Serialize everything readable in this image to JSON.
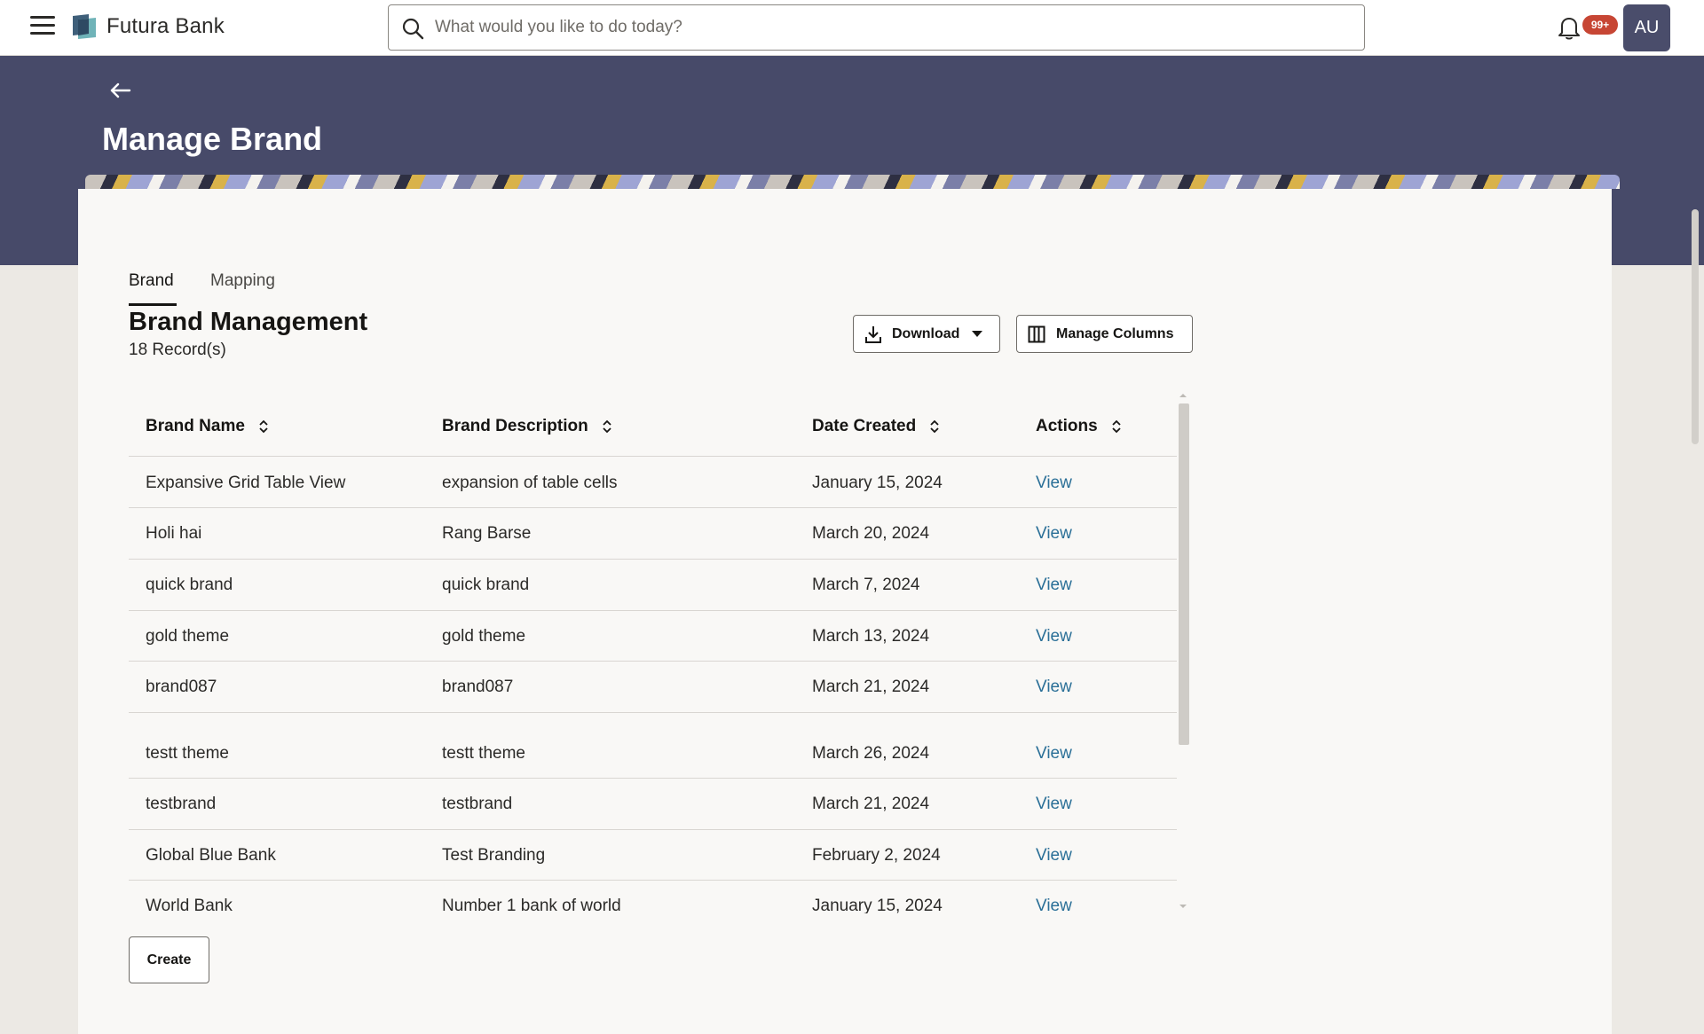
{
  "app": {
    "name": "Futura Bank",
    "search_placeholder": "What would you like to do today?",
    "notification_count": "99+",
    "user_initials": "AU"
  },
  "page": {
    "title": "Manage Brand"
  },
  "tabs": [
    {
      "label": "Brand",
      "active": true
    },
    {
      "label": "Mapping",
      "active": false
    }
  ],
  "section": {
    "title": "Brand Management",
    "record_count": "18 Record(s)"
  },
  "toolbar": {
    "download_label": "Download",
    "manage_columns_label": "Manage Columns"
  },
  "table": {
    "headers": [
      "Brand Name",
      "Brand Description",
      "Date Created",
      "Actions"
    ],
    "rows": [
      {
        "name": "Expansive Grid Table View",
        "description": "expansion of table cells",
        "date": "January 15, 2024",
        "action": "View"
      },
      {
        "name": "Holi hai",
        "description": "Rang Barse",
        "date": "March 20, 2024",
        "action": "View"
      },
      {
        "name": "quick brand",
        "description": "quick brand",
        "date": "March 7, 2024",
        "action": "View"
      },
      {
        "name": "gold theme",
        "description": "gold theme",
        "date": "March 13, 2024",
        "action": "View"
      },
      {
        "name": "brand087",
        "description": "brand087",
        "date": "March 21, 2024",
        "action": "View"
      },
      {
        "name": "testt theme",
        "description": "testt theme",
        "date": "March 26, 2024",
        "action": "View"
      },
      {
        "name": "testbrand",
        "description": "testbrand",
        "date": "March 21, 2024",
        "action": "View"
      },
      {
        "name": "Global Blue Bank",
        "description": "Test Branding",
        "date": "February 2, 2024",
        "action": "View"
      },
      {
        "name": "World Bank",
        "description": "Number 1 bank of world",
        "date": "January 15, 2024",
        "action": "View"
      }
    ]
  },
  "footer": {
    "create_label": "Create"
  },
  "colors": {
    "banner": "#474a69",
    "link": "#2a6f97",
    "badge": "#c74634",
    "avatar": "#4a4d6b"
  },
  "icons": {
    "menu": "hamburger-icon",
    "logo": "bank-logo-icon",
    "search": "search-icon",
    "notifications": "bell-icon",
    "back": "arrow-left-icon",
    "download": "download-icon",
    "columns": "columns-icon",
    "sort": "sort-icon"
  }
}
